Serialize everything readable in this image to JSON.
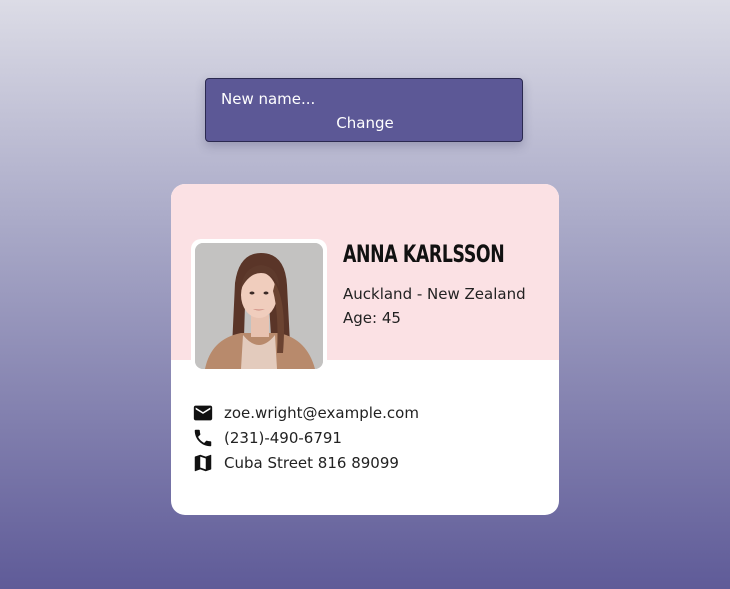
{
  "name_form": {
    "input_placeholder": "New name...",
    "input_value": "",
    "change_label": "Change"
  },
  "profile": {
    "name": "Anna Karlsson",
    "location": "Auckland - New Zealand",
    "age_label": "Age:",
    "age": "45"
  },
  "contacts": [
    {
      "icon": "email-icon",
      "text": "zoe.wright@example.com"
    },
    {
      "icon": "phone-icon",
      "text": "(231)-490-6791"
    },
    {
      "icon": "map-icon",
      "text": "Cuba Street 816 89099"
    }
  ],
  "colors": {
    "form_background": "#5c5896",
    "card_header": "#fbe1e4",
    "card_body": "#ffffff"
  }
}
